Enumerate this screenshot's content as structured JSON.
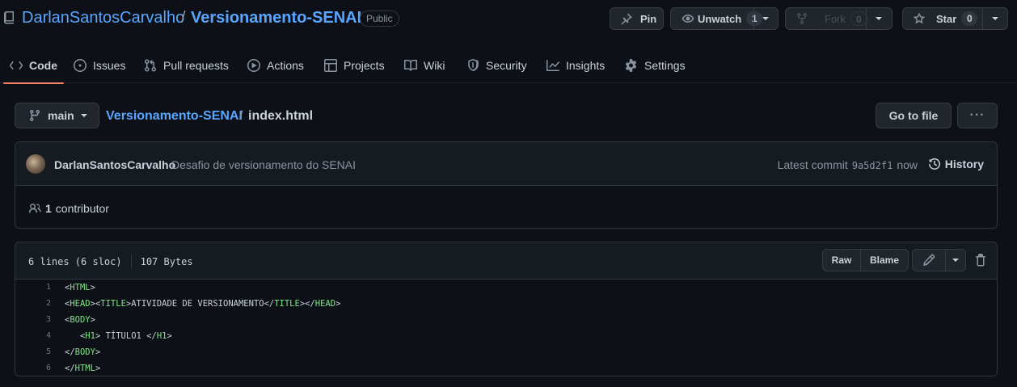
{
  "repo": {
    "owner": "DarlanSantosCarvalho",
    "separator": "/",
    "name": "Versionamento-SENAI",
    "visibility": "Public",
    "icon": "repo-icon"
  },
  "actions": {
    "pin": "Pin",
    "unwatch": "Unwatch",
    "watch_count": "1",
    "fork": "Fork",
    "fork_count": "0",
    "star": "Star",
    "star_count": "0"
  },
  "tabs": [
    {
      "label": "Code",
      "icon": "code-icon",
      "active": true
    },
    {
      "label": "Issues",
      "icon": "issue-icon"
    },
    {
      "label": "Pull requests",
      "icon": "pull-request-icon"
    },
    {
      "label": "Actions",
      "icon": "play-icon"
    },
    {
      "label": "Projects",
      "icon": "table-icon"
    },
    {
      "label": "Wiki",
      "icon": "book-icon"
    },
    {
      "label": "Security",
      "icon": "shield-icon"
    },
    {
      "label": "Insights",
      "icon": "graph-icon"
    },
    {
      "label": "Settings",
      "icon": "gear-icon"
    }
  ],
  "branch": {
    "name": "main",
    "icon": "git-branch-icon"
  },
  "breadcrumb": {
    "repo": "Versionamento-SENAI",
    "separator": "/",
    "file": "index.html"
  },
  "go_to_file": "Go to file",
  "more_label": "···",
  "commit": {
    "author": "DarlanSantosCarvalho",
    "message": "Desafio de versionamento do SENAI",
    "latest_label": "Latest commit",
    "sha": "9a5d2f1",
    "time": "now",
    "history": "History"
  },
  "contributors": {
    "count": "1",
    "label": "contributor"
  },
  "file": {
    "lines_info": "6 lines (6 sloc)",
    "size": "107 Bytes",
    "raw": "Raw",
    "blame": "Blame"
  },
  "code_lines": [
    {
      "n": "1",
      "parts": [
        [
          "pun",
          "<"
        ],
        [
          "tag",
          "HTML"
        ],
        [
          "pun",
          ">"
        ]
      ]
    },
    {
      "n": "2",
      "parts": [
        [
          "pun",
          "<"
        ],
        [
          "tag",
          "HEAD"
        ],
        [
          "pun",
          "><"
        ],
        [
          "tag",
          "TITLE"
        ],
        [
          "pun",
          ">ATIVIDADE DE VERSIONAMENTO</"
        ],
        [
          "tag",
          "TITLE"
        ],
        [
          "pun",
          "></"
        ],
        [
          "tag",
          "HEAD"
        ],
        [
          "pun",
          ">"
        ]
      ]
    },
    {
      "n": "3",
      "parts": [
        [
          "pun",
          "<"
        ],
        [
          "tag",
          "BODY"
        ],
        [
          "pun",
          ">"
        ]
      ]
    },
    {
      "n": "4",
      "parts": [
        [
          "pun",
          "   <"
        ],
        [
          "tag",
          "H1"
        ],
        [
          "pun",
          "> TÍTULO1 </"
        ],
        [
          "tag",
          "H1"
        ],
        [
          "pun",
          ">"
        ]
      ]
    },
    {
      "n": "5",
      "parts": [
        [
          "pun",
          "</"
        ],
        [
          "tag",
          "BODY"
        ],
        [
          "pun",
          ">"
        ]
      ]
    },
    {
      "n": "6",
      "parts": [
        [
          "pun",
          "</"
        ],
        [
          "tag",
          "HTML"
        ],
        [
          "pun",
          ">"
        ]
      ]
    }
  ],
  "colors": {
    "link": "#58a6ff",
    "tag": "#7ee787",
    "tab_underline": "#f78166",
    "background": "#0d1117"
  }
}
